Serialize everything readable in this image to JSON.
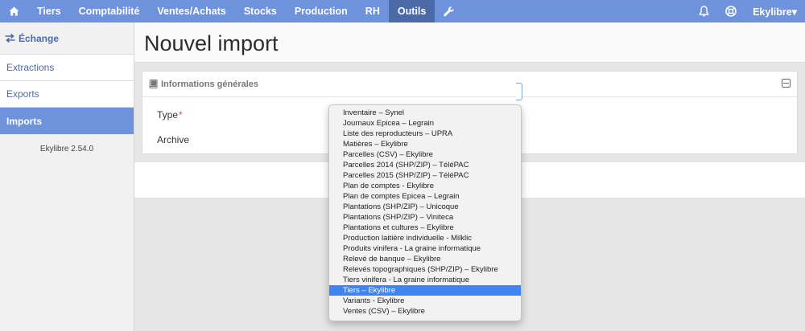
{
  "topnav": {
    "home_icon": "home-icon",
    "items": [
      "Tiers",
      "Comptabilité",
      "Ventes/Achats",
      "Stocks",
      "Production",
      "RH",
      "Outils"
    ],
    "active": "Outils",
    "wrench_icon": "wrench-icon",
    "bell_icon": "bell-icon",
    "help_icon": "lifebuoy-icon",
    "user_menu": "Ekylibre▾"
  },
  "sidebar": {
    "section_title": "Échange",
    "section_icon": "exchange-icon",
    "items": [
      "Extractions",
      "Exports",
      "Imports"
    ],
    "active": "Imports",
    "version": "Ekylibre 2.54.0"
  },
  "page": {
    "title": "Nouvel import"
  },
  "panel": {
    "title": "Informations générales",
    "title_icon": "book-icon",
    "type_label": "Type",
    "required_mark": "*",
    "archive_label": "Archive"
  },
  "type_select": {
    "selected": "Tiers – Ekylibre",
    "options": [
      "Inventaire – Synel",
      "Journaux Epicea – Legrain",
      "Liste des reproducteurs – UPRA",
      "Matières – Ekylibre",
      "Parcelles (CSV) – Ekylibre",
      "Parcelles 2014 (SHP/ZIP) – TéléPAC",
      "Parcelles 2015 (SHP/ZIP) – TéléPAC",
      "Plan de comptes - Ekylibre",
      "Plan de comptes Epicea – Legrain",
      "Plantations (SHP/ZIP) – Unicoque",
      "Plantations (SHP/ZIP) – Viniteca",
      "Plantations et cultures – Ekylibre",
      "Production laitière individuelle - Milklic",
      "Produits vinifera - La graine informatique",
      "Relevé de banque – Ekylibre",
      "Relevés topographiques (SHP/ZIP) – Ekylibre",
      "Tiers vinifera - La graine informatique",
      "Tiers – Ekylibre",
      "Variants - Ekylibre",
      "Ventes (CSV) – Ekylibre"
    ]
  },
  "colors": {
    "nav_bg": "#6f92dc",
    "nav_active": "#4d6aa8",
    "selection": "#3f84f0"
  }
}
